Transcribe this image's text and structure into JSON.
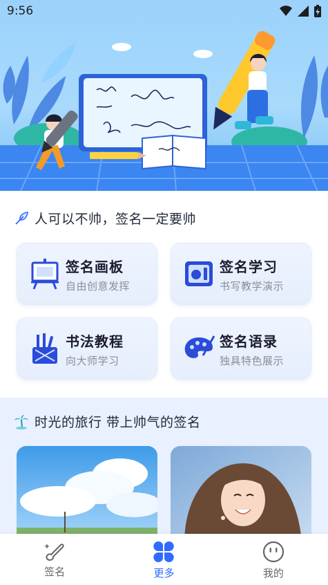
{
  "status_bar": {
    "time": "9:56"
  },
  "section1": {
    "title": "人可以不帅，签名一定要帅",
    "cards": [
      {
        "title": "签名画板",
        "subtitle": "自由创意发挥"
      },
      {
        "title": "签名学习",
        "subtitle": "书写教学演示"
      },
      {
        "title": "书法教程",
        "subtitle": "向大师学习"
      },
      {
        "title": "签名语录",
        "subtitle": "独具特色展示"
      }
    ]
  },
  "section2": {
    "title": "时光的旅行 带上帅气的签名"
  },
  "bottom_nav": {
    "items": [
      {
        "label": "签名",
        "icon": "brush-sparkle-icon"
      },
      {
        "label": "更多",
        "icon": "four-petal-grid-icon"
      },
      {
        "label": "我的",
        "icon": "smiley-face-icon"
      }
    ],
    "active_index": 1
  },
  "colors": {
    "accent": "#2f6bff",
    "banner_sky": "#9ed3fb",
    "section2_bg": "#e9f0ff"
  }
}
